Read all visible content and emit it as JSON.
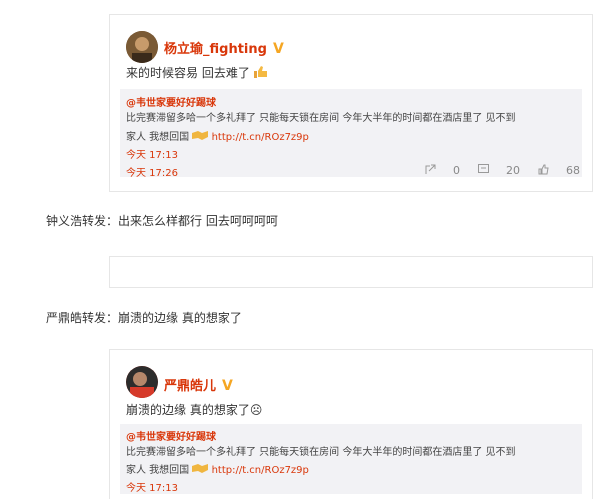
{
  "post1": {
    "username": "杨立瑜_fighting",
    "text": "来的时候容易 回去难了",
    "quote": {
      "author": "@韦世家要好好踢球",
      "line1": "比完赛滞留多哈一个多礼拜了 只能每天锁在房间 今年大半年的时间都在酒店里了 见不到",
      "line2": "家人 我想回国",
      "link": "http://t.cn/ROz7z9p",
      "time": "今天 17:13"
    },
    "time": "今天 17:26",
    "actions": {
      "forward": "0",
      "comment": "20",
      "like": "68"
    }
  },
  "forward1": {
    "text": "钟义浩转发：出来怎么样都行 回去呵呵呵呵"
  },
  "forward2": {
    "text": "严鼎皓转发：崩溃的边缘 真的想家了"
  },
  "post2": {
    "username": "严鼎皓儿",
    "text": "崩溃的边缘 真的想家了☹",
    "quote": {
      "author": "@韦世家要好好踢球",
      "line1": "比完赛滞留多哈一个多礼拜了 只能每天锁在房间 今年大半年的时间都在酒店里了 见不到",
      "line2": "家人 我想回国",
      "link": "http://t.cn/ROz7z9p",
      "time": "今天 17:13"
    }
  },
  "icons": {
    "verified": "verified-v-icon",
    "thumbs_up": "thumbs-up-emoji",
    "handshake": "handshake-emoji",
    "forward": "forward-icon",
    "comment": "comment-icon",
    "like": "like-icon"
  },
  "colors": {
    "accent": "#d9370a",
    "verified": "#f5a623",
    "quote_bg": "#f2f2f5"
  }
}
